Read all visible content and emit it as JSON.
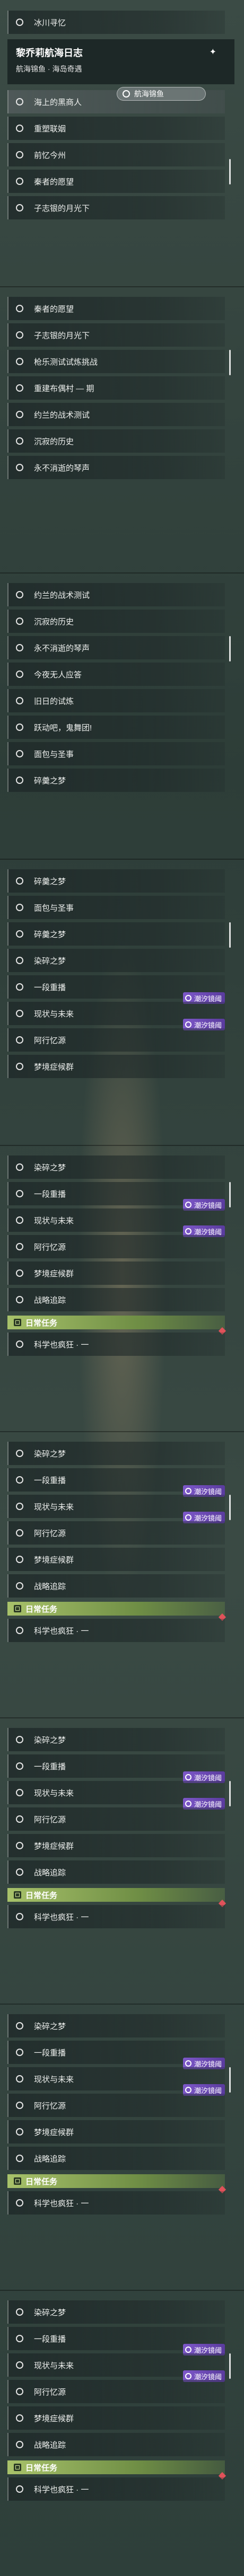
{
  "popup": {
    "title": "黎乔莉航海日志",
    "subtitle": "航海锦鱼 · 海岛奇遇",
    "nav_label": "航海锦鱼"
  },
  "tag_label": "潮汐镜阈",
  "daily_label": "日常任务",
  "panels": [
    {
      "rows": [
        "冰川寻忆",
        "",
        "",
        "海上的黑商人",
        "重塑联姻",
        "前忆今州",
        "秦者的愿望",
        "子志银的月光下"
      ]
    },
    {
      "rows": [
        "秦者的愿望",
        "子志银的月光下",
        "枪乐测试试炼挑战",
        "重建布偶村 — 期",
        "约兰的战术测试",
        "沉寂的历史",
        "永不消逝的琴声"
      ]
    },
    {
      "rows": [
        "约兰的战术测试",
        "沉寂的历史",
        "永不消逝的琴声",
        "今夜无人应答",
        "旧日的试炼",
        "跃动吧，鬼舞团!",
        "面包与圣事",
        "碎羹之梦"
      ]
    },
    {
      "rows": [
        "碎羹之梦",
        "面包与圣事",
        "碎羹之梦",
        "染碎之梦",
        "一段重播",
        "现状与未来",
        "阿行忆源",
        "梦境症候群"
      ]
    },
    {
      "rows": [
        "染碎之梦",
        "一段重播",
        "现状与未来",
        "阿行忆源",
        "梦境症候群",
        "战略追踪"
      ],
      "daily": [
        "科学也疯狂 · 一"
      ]
    },
    {
      "rows": [
        "染碎之梦",
        "一段重播",
        "现状与未来",
        "阿行忆源",
        "梦境症候群",
        "战略追踪"
      ],
      "daily": [
        "科学也疯狂 · 一"
      ]
    },
    {
      "rows": [
        "染碎之梦",
        "一段重播",
        "现状与未来",
        "阿行忆源",
        "梦境症候群",
        "战略追踪"
      ],
      "daily": [
        "科学也疯狂 · 一"
      ]
    },
    {
      "rows": [
        "染碎之梦",
        "一段重播",
        "现状与未来",
        "阿行忆源",
        "梦境症候群",
        "战略追踪"
      ],
      "daily": [
        "科学也疯狂 · 一"
      ]
    },
    {
      "rows": [
        "染碎之梦",
        "一段重播",
        "现状与未来",
        "阿行忆源",
        "梦境症候群",
        "战略追踪"
      ],
      "daily": [
        "科学也疯狂 · 一"
      ]
    }
  ]
}
